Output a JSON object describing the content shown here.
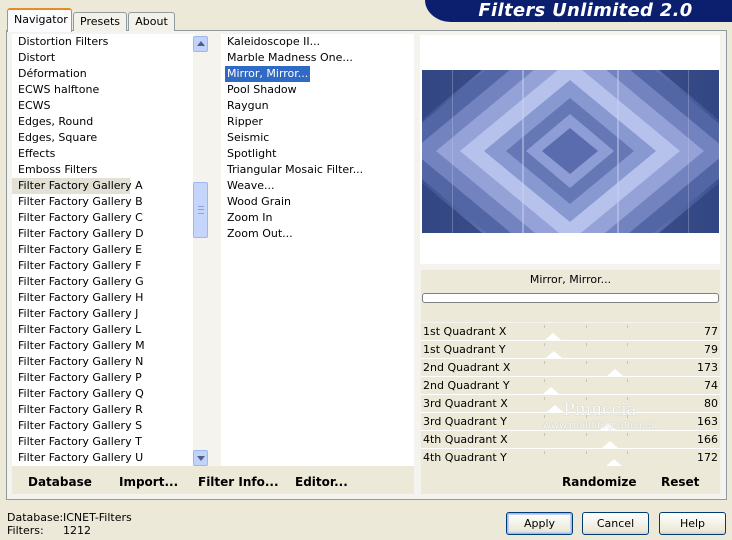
{
  "title": "Filters Unlimited 2.0",
  "tabs": [
    "Navigator",
    "Presets",
    "About"
  ],
  "categories": [
    "Distortion Filters",
    "Distort",
    "Déformation",
    "ECWS halftone",
    "ECWS",
    "Edges, Round",
    "Edges, Square",
    "Effects",
    "Emboss Filters",
    "Filter Factory Gallery A",
    "Filter Factory Gallery B",
    "Filter Factory Gallery C",
    "Filter Factory Gallery D",
    "Filter Factory Gallery E",
    "Filter Factory Gallery F",
    "Filter Factory Gallery G",
    "Filter Factory Gallery H",
    "Filter Factory Gallery J",
    "Filter Factory Gallery L",
    "Filter Factory Gallery M",
    "Filter Factory Gallery N",
    "Filter Factory Gallery P",
    "Filter Factory Gallery Q",
    "Filter Factory Gallery R",
    "Filter Factory Gallery S",
    "Filter Factory Gallery T",
    "Filter Factory Gallery U"
  ],
  "selected_category": "Filter Factory Gallery A",
  "filters": [
    "Kaleidoscope II...",
    "Marble Madness One...",
    "Mirror, Mirror...",
    "Pool Shadow",
    "Raygun",
    "Ripper",
    "Seismic",
    "Spotlight",
    "Triangular Mosaic Filter...",
    "Weave...",
    "Wood Grain",
    "Zoom In",
    "Zoom Out..."
  ],
  "selected_filter": "Mirror, Mirror...",
  "current_filter_name": "Mirror, Mirror...",
  "params": [
    {
      "label": "1st Quadrant X",
      "value": "77",
      "level": 77
    },
    {
      "label": "1st Quadrant Y",
      "value": "79",
      "level": 79
    },
    {
      "label": "2nd Quadrant X",
      "value": "173",
      "level": 173
    },
    {
      "label": "2nd Quadrant Y",
      "value": "74",
      "level": 74
    },
    {
      "label": "3rd Quadrant X",
      "value": "80",
      "level": 80
    },
    {
      "label": "3rd Quadrant Y",
      "value": "163",
      "level": 163
    },
    {
      "label": "4th Quadrant X",
      "value": "166",
      "level": 166
    },
    {
      "label": "4th Quadrant Y",
      "value": "172",
      "level": 172
    }
  ],
  "param_max": 255,
  "panel_buttons": {
    "database": "Database",
    "import": "Import...",
    "filter_info": "Filter Info...",
    "editor": "Editor...",
    "randomize": "Randomize",
    "reset": "Reset"
  },
  "footer": {
    "database_label": "Database:",
    "database_value": "ICNET-Filters",
    "filters_label": "Filters:",
    "filters_value": "1212"
  },
  "buttons": {
    "apply": "Apply",
    "cancel": "Cancel",
    "help": "Help"
  },
  "watermark": {
    "name": "Pinuccia",
    "url": "www.maidiregrafica.eu"
  },
  "colors": {
    "banner": "#0b1f6e",
    "selection": "#316ac5",
    "preview_dark": "#3a4f8e",
    "preview_light": "#a9b6e4"
  }
}
